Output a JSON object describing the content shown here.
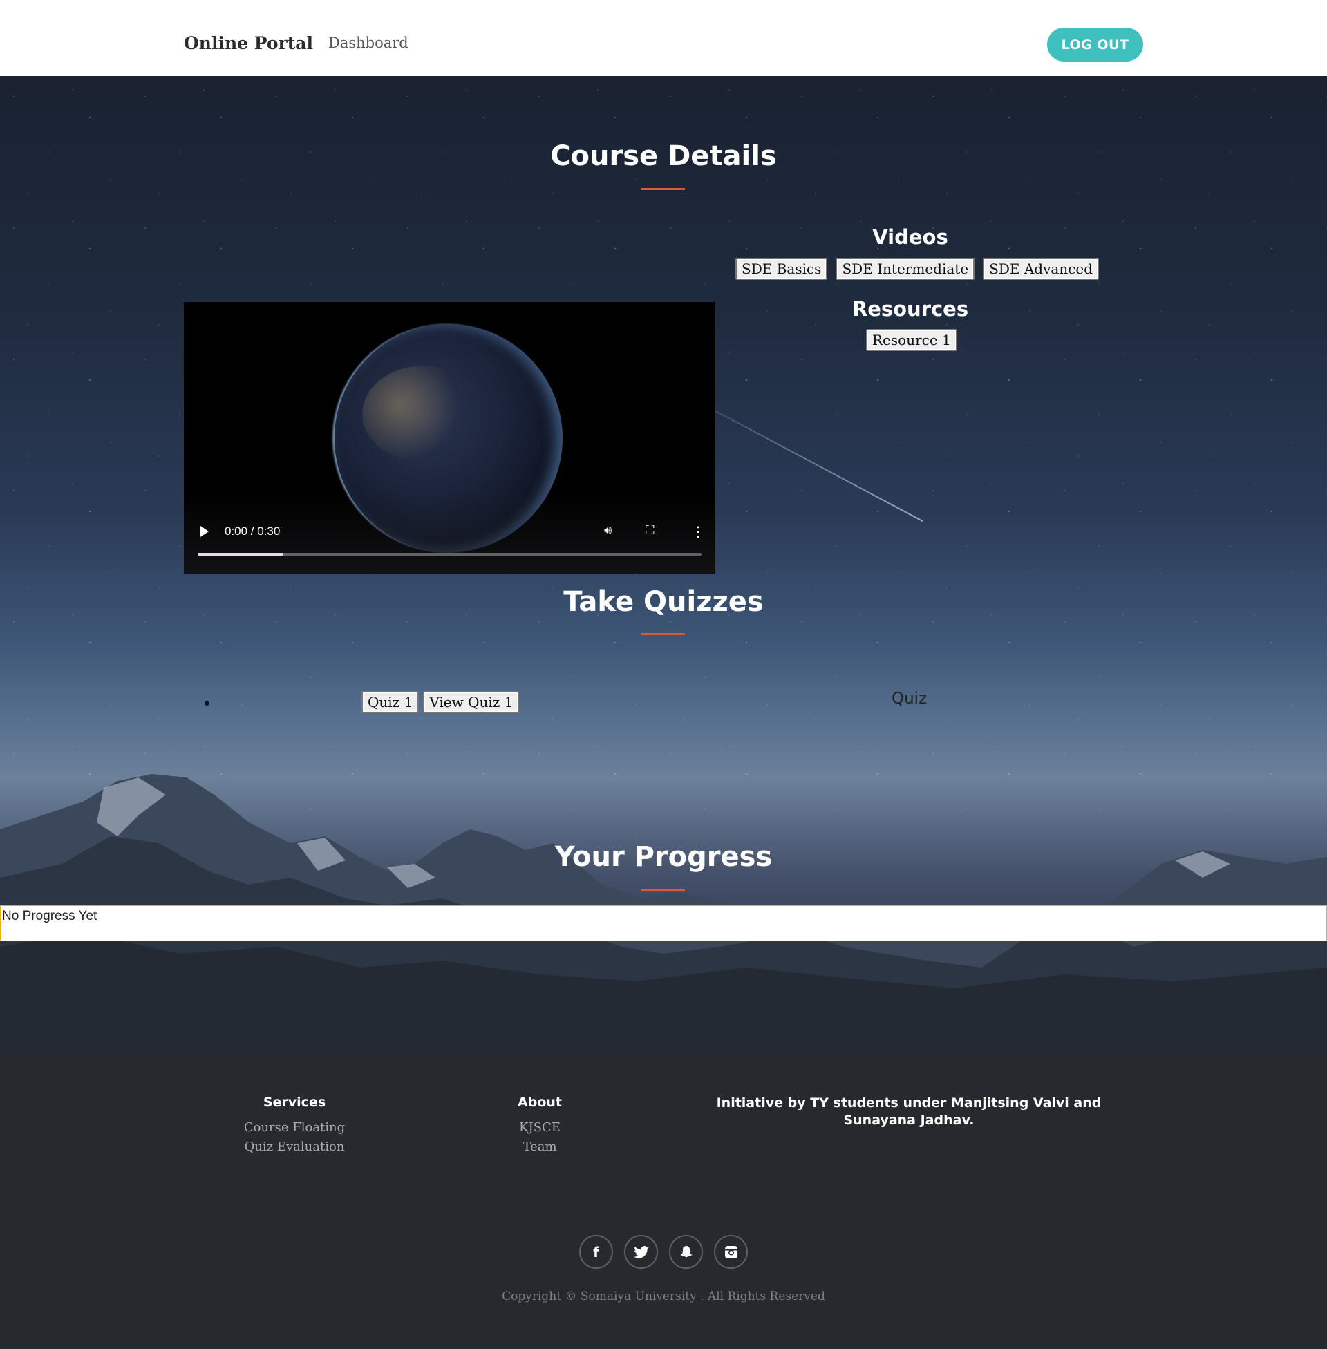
{
  "navbar": {
    "brand": "Online Portal",
    "dashboard_link": "Dashboard",
    "logout_label": "LOG OUT"
  },
  "course_details": {
    "title": "Course Details",
    "video_player": {
      "time": "0:00 / 0:30",
      "progress_fraction": 0.17,
      "icons": [
        "play-icon",
        "volume-icon",
        "fullscreen-icon",
        "more-options-icon"
      ]
    },
    "videos_heading": "Videos",
    "videos": [
      "SDE Basics",
      "SDE Intermediate",
      "SDE Advanced"
    ],
    "resources_heading": "Resources",
    "resources": [
      "Resource 1"
    ]
  },
  "quizzes": {
    "title": "Take Quizzes",
    "buttons": [
      "Quiz 1",
      "View Quiz 1"
    ],
    "label": "Quiz"
  },
  "progress": {
    "title": "Your Progress",
    "empty_text": "No Progress Yet"
  },
  "footer": {
    "services_heading": "Services",
    "services": [
      "Course Floating",
      "Quiz Evaluation"
    ],
    "about_heading": "About",
    "about": [
      "KJSCE",
      "Team"
    ],
    "initiative": "Initiative by TY students under Manjitsing Valvi and Sunayana Jadhav.",
    "socials": [
      "facebook-icon",
      "twitter-icon",
      "snapchat-icon",
      "instagram-icon"
    ],
    "copyright": "Copyright © Somaiya University . All Rights Reserved"
  },
  "colors": {
    "accent": "#3fbfbd",
    "title_underline": "#e2583e",
    "footer_bg": "#262a2e"
  }
}
